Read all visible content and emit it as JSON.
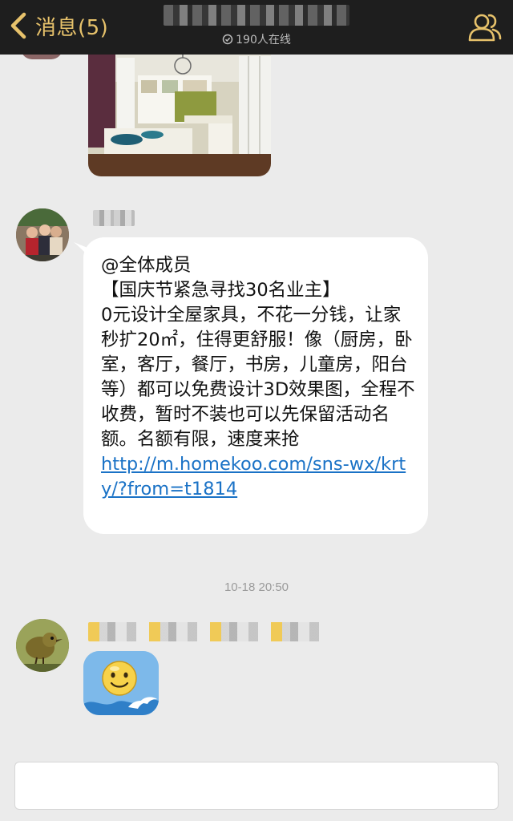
{
  "header": {
    "back_label": "消息(5)",
    "online_text": "190人在线"
  },
  "messages": {
    "text_message": {
      "mention": "@全体成员",
      "body": "【国庆节紧急寻找30名业主】\n0元设计全屋家具，不花一分钱，让家秒扩20㎡，住得更舒服！像（厨房，卧室，客厅，餐厅，书房，儿童房，阳台等）都可以免费设计3D效果图，全程不收费，暂时不装也可以先保留活动名额。名额有限，速度来抢",
      "link": "http://m.homekoo.com/sns-wx/krty/?from=t1814"
    },
    "timestamp": "10-18 20:50"
  },
  "input": {
    "value": ""
  },
  "icons": {
    "back": "chevron-left-icon",
    "online": "online-status-icon",
    "members": "group-members-icon",
    "sticker": "smiley-sticker-icon"
  },
  "colors": {
    "topbar_bg": "#1e1e1e",
    "accent_gold": "#e7c26b",
    "chat_bg": "#ebebeb",
    "link": "#1a72c6",
    "sticker_bubble": "#78b6e9"
  }
}
